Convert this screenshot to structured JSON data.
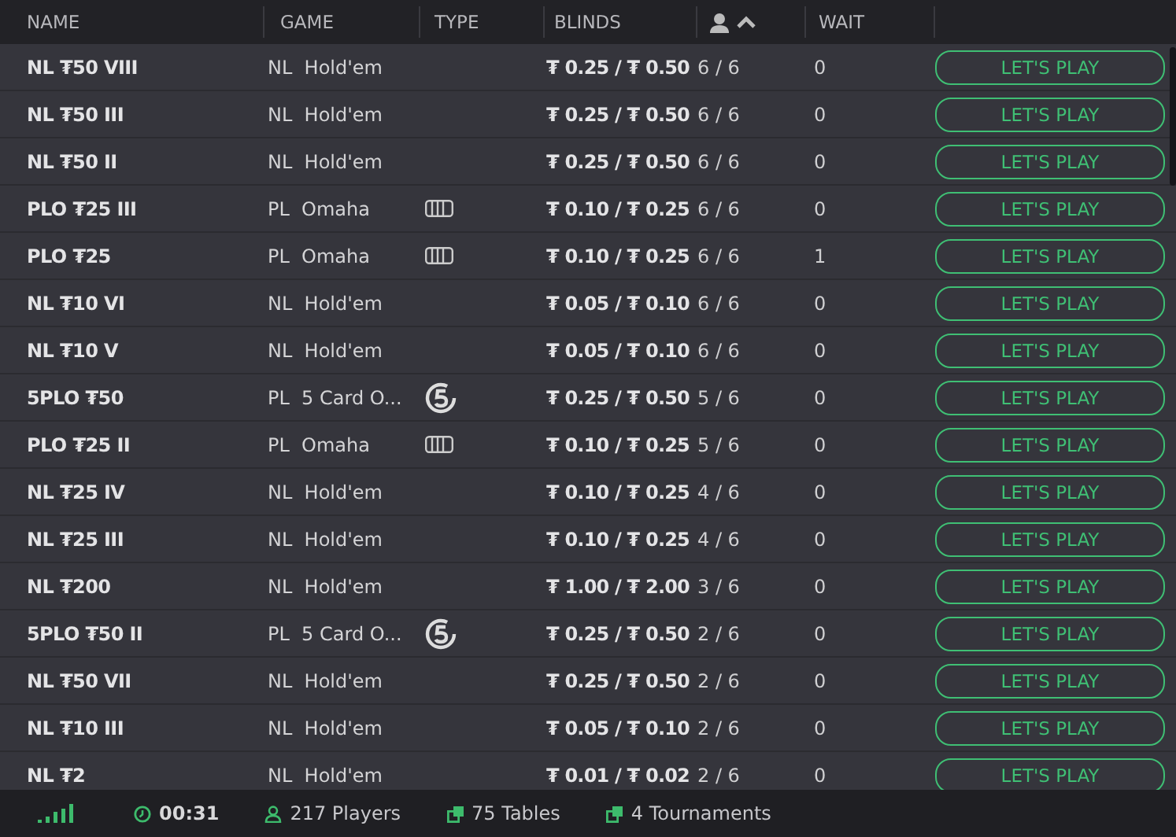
{
  "columns": [
    {
      "kind": "text",
      "label": "NAME"
    },
    {
      "kind": "text",
      "label": "GAME"
    },
    {
      "kind": "text",
      "label": "TYPE"
    },
    {
      "kind": "text",
      "label": "BLINDS"
    },
    {
      "kind": "players"
    },
    {
      "kind": "text",
      "label": "WAIT"
    },
    {
      "kind": "blank"
    }
  ],
  "rows": [
    {
      "name": "NL ₮50 VIII",
      "game": "NL  Hold'em",
      "blinds": "₮ 0.25 / ₮ 0.50",
      "players": "6 / 6",
      "wait": "0",
      "action": "LET'S PLAY"
    },
    {
      "name": "NL ₮50 III",
      "game": "NL  Hold'em",
      "blinds": "₮ 0.25 / ₮ 0.50",
      "players": "6 / 6",
      "wait": "0",
      "action": "LET'S PLAY"
    },
    {
      "name": "NL ₮50 II",
      "game": "NL  Hold'em",
      "blinds": "₮ 0.25 / ₮ 0.50",
      "players": "6 / 6",
      "wait": "0",
      "action": "LET'S PLAY"
    },
    {
      "name": "PLO ₮25 III",
      "game": "PL  Omaha",
      "kind": "four",
      "blinds": "₮ 0.10 / ₮ 0.25",
      "players": "6 / 6",
      "wait": "0",
      "action": "LET'S PLAY"
    },
    {
      "name": "PLO ₮25",
      "game": "PL  Omaha",
      "kind": "four",
      "blinds": "₮ 0.10 / ₮ 0.25",
      "players": "6 / 6",
      "wait": "1",
      "action": "LET'S PLAY"
    },
    {
      "name": "NL ₮10 VI",
      "game": "NL  Hold'em",
      "blinds": "₮ 0.05 / ₮ 0.10",
      "players": "6 / 6",
      "wait": "0",
      "action": "LET'S PLAY"
    },
    {
      "name": "NL ₮10 V",
      "game": "NL  Hold'em",
      "blinds": "₮ 0.05 / ₮ 0.10",
      "players": "6 / 6",
      "wait": "0",
      "action": "LET'S PLAY"
    },
    {
      "name": "5PLO ₮50",
      "game": "PL  5 Card O...",
      "kind": "five",
      "blinds": "₮ 0.25 / ₮ 0.50",
      "players": "5 / 6",
      "wait": "0",
      "action": "LET'S PLAY"
    },
    {
      "name": "PLO ₮25 II",
      "game": "PL  Omaha",
      "kind": "four",
      "blinds": "₮ 0.10 / ₮ 0.25",
      "players": "5 / 6",
      "wait": "0",
      "action": "LET'S PLAY"
    },
    {
      "name": "NL ₮25 IV",
      "game": "NL  Hold'em",
      "blinds": "₮ 0.10 / ₮ 0.25",
      "players": "4 / 6",
      "wait": "0",
      "action": "LET'S PLAY"
    },
    {
      "name": "NL ₮25 III",
      "game": "NL  Hold'em",
      "blinds": "₮ 0.10 / ₮ 0.25",
      "players": "4 / 6",
      "wait": "0",
      "action": "LET'S PLAY"
    },
    {
      "name": "NL ₮200",
      "game": "NL  Hold'em",
      "blinds": "₮ 1.00 / ₮ 2.00",
      "players": "3 / 6",
      "wait": "0",
      "action": "LET'S PLAY"
    },
    {
      "name": "5PLO ₮50 II",
      "game": "PL  5 Card O...",
      "kind": "five",
      "blinds": "₮ 0.25 / ₮ 0.50",
      "players": "2 / 6",
      "wait": "0",
      "action": "LET'S PLAY"
    },
    {
      "name": "NL ₮50 VII",
      "game": "NL  Hold'em",
      "blinds": "₮ 0.25 / ₮ 0.50",
      "players": "2 / 6",
      "wait": "0",
      "action": "LET'S PLAY"
    },
    {
      "name": "NL ₮10 III",
      "game": "NL  Hold'em",
      "blinds": "₮ 0.05 / ₮ 0.10",
      "players": "2 / 6",
      "wait": "0",
      "action": "LET'S PLAY"
    },
    {
      "name": "NL ₮2",
      "game": "NL  Hold'em",
      "blinds": "₮ 0.01 / ₮ 0.02",
      "players": "2 / 6",
      "wait": "0",
      "action": "LET'S PLAY"
    }
  ],
  "status_bar": {
    "time": "00:31",
    "players": "217 Players",
    "tables": "75 Tables",
    "tournaments": "4 Tournaments"
  }
}
